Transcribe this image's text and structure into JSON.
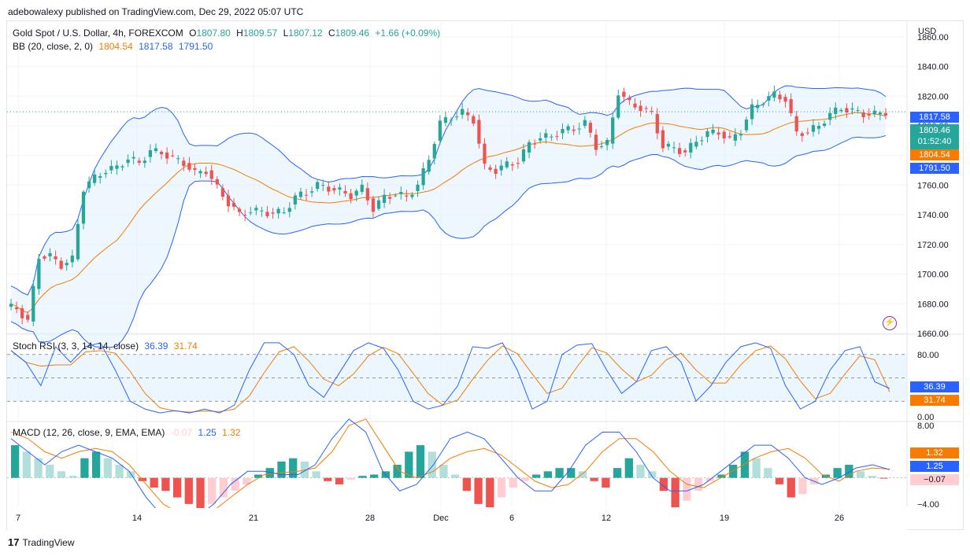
{
  "header": {
    "publisher_text": "adebowalexy published on TradingView.com, Dec 29, 2022 05:07 UTC"
  },
  "footer": {
    "brand": "TradingView"
  },
  "main_legend": {
    "symbol": "Gold Spot / U.S. Dollar, 4h, FOREXCOM",
    "open_label": "O",
    "open": "1807.80",
    "high_label": "H",
    "high": "1809.57",
    "low_label": "L",
    "low": "1807.12",
    "close_label": "C",
    "close": "1809.46",
    "change": "+1.66 (+0.09%)",
    "bb_label": "BB (20, close, 2, 0)",
    "bb_basis": "1804.54",
    "bb_upper": "1817.58",
    "bb_lower": "1791.50"
  },
  "stoch_legend": {
    "label": "Stoch RSI (3, 3, 14, 14, close)",
    "k": "36.39",
    "d": "31.74"
  },
  "macd_legend": {
    "label": "MACD (12, 26, close, 9, EMA, EMA)",
    "hist": "-0.07",
    "macd": "1.25",
    "signal": "1.32"
  },
  "price_axis": {
    "currency": "USD"
  },
  "badges": {
    "upper": "1817.58",
    "price": "1809.46",
    "countdown": "01:52:40",
    "basis": "1804.54",
    "lower": "1791.50",
    "stoch_k": "36.39",
    "stoch_d": "31.74",
    "macd_signal": "1.32",
    "macd_line": "1.25",
    "macd_hist": "−0.07"
  },
  "colors": {
    "up": "#26a69a",
    "down": "#ef5350",
    "bb_band": "#2962ff",
    "bb_basis": "#f57c00",
    "band_fill": "#e3f2fd",
    "stoch_k": "#2962ff",
    "stoch_d": "#f57c00",
    "hist_up_strong": "#26a69a",
    "hist_up_weak": "#b2dfdb",
    "hist_down_strong": "#ef5350",
    "hist_down_weak": "#ffcdd2"
  },
  "chart_data": [
    {
      "type": "candlestick",
      "title": "Gold Spot / U.S. Dollar, 4h, FOREXCOM",
      "x_ticks": [
        "7",
        "14",
        "21",
        "28",
        "Dec",
        "6",
        "12",
        "19",
        "26"
      ],
      "y_ticks": [
        1660,
        1680,
        1700,
        1720,
        1740,
        1760,
        1780,
        1800,
        1820,
        1840,
        1860
      ],
      "y_tick_labels": [
        "1660.00",
        "1680.00",
        "1700.00",
        "1720.00",
        "1740.00",
        "1760.00",
        "1780.00",
        "1800.00",
        "1820.00",
        "1840.00",
        "1860.00"
      ],
      "ylim": [
        1660,
        1870
      ],
      "grid": true,
      "close_path": [
        1678,
        1677,
        1668,
        1712,
        1712,
        1706,
        1710,
        1758,
        1765,
        1770,
        1772,
        1778,
        1775,
        1783,
        1782,
        1778,
        1775,
        1768,
        1770,
        1758,
        1748,
        1740,
        1743,
        1742,
        1741,
        1742,
        1752,
        1755,
        1760,
        1758,
        1756,
        1753,
        1758,
        1744,
        1752,
        1754,
        1752,
        1760,
        1778,
        1802,
        1806,
        1809,
        1804,
        1772,
        1770,
        1774,
        1776,
        1788,
        1792,
        1793,
        1797,
        1798,
        1802,
        1786,
        1788,
        1823,
        1815,
        1812,
        1808,
        1786,
        1785,
        1782,
        1790,
        1795,
        1796,
        1790,
        1797,
        1812,
        1817,
        1821,
        1818,
        1795,
        1796,
        1800,
        1808,
        1812,
        1810,
        1808,
        1807.8,
        1809.46
      ],
      "last_close": 1809.46,
      "bollinger": {
        "basis": 1804.54,
        "upper": 1817.58,
        "lower": 1791.5
      }
    },
    {
      "type": "line",
      "title": "Stoch RSI (3, 3, 14, 14, close)",
      "y_ticks": [
        0,
        80
      ],
      "y_tick_labels": [
        "0.00",
        "80.00"
      ],
      "ylim": [
        -5,
        105
      ],
      "bands": [
        20,
        50,
        80
      ],
      "k_path": [
        85,
        70,
        40,
        90,
        70,
        90,
        95,
        60,
        20,
        10,
        5,
        8,
        5,
        10,
        5,
        15,
        60,
        95,
        95,
        80,
        40,
        25,
        55,
        85,
        95,
        88,
        60,
        20,
        10,
        15,
        40,
        90,
        88,
        95,
        60,
        10,
        20,
        80,
        92,
        94,
        60,
        30,
        45,
        85,
        90,
        70,
        20,
        40,
        70,
        90,
        95,
        88,
        40,
        10,
        20,
        60,
        85,
        90,
        45,
        36.39
      ],
      "series": [
        {
          "name": "K",
          "last": 36.39
        },
        {
          "name": "D",
          "last": 31.74
        }
      ]
    },
    {
      "type": "bar",
      "title": "MACD (12, 26, close, 9, EMA, EMA)",
      "y_ticks": [
        8,
        -4
      ],
      "y_tick_labels": [
        "8.00",
        "−4.00"
      ],
      "ylim": [
        -4.5,
        8.5
      ],
      "hist_path": [
        5,
        4,
        3,
        2,
        1,
        0.3,
        3,
        4,
        3,
        2,
        1,
        -0.5,
        -1.5,
        -2,
        -3,
        -4,
        -5,
        -4,
        -3,
        -2,
        -1,
        0.5,
        1.5,
        2.5,
        3,
        2.5,
        1,
        -0.5,
        -1,
        -0.3,
        0.3,
        0.5,
        1,
        2,
        4,
        5,
        4,
        2,
        0.5,
        -2,
        -4,
        -4.5,
        -3,
        -1.5,
        -0.5,
        0.5,
        1,
        1.5,
        1.5,
        1,
        -0.5,
        -1.5,
        1.5,
        3,
        2,
        1,
        -2,
        -4.5,
        -3.5,
        -2,
        -0.5,
        0.5,
        2,
        4,
        3,
        1.5,
        -1,
        -3,
        -2.5,
        -1,
        0.5,
        1.5,
        2,
        1,
        0.3,
        -0.07
      ],
      "macd_path": [
        6,
        4,
        2,
        4,
        5,
        4,
        3,
        1,
        -3,
        -6,
        -7,
        -6,
        -4,
        -1,
        1,
        1,
        0.5,
        0.5,
        2,
        6,
        9,
        7,
        1,
        -2,
        -1,
        2,
        6,
        7,
        6,
        3,
        0,
        -2,
        -2,
        1,
        5,
        7,
        7,
        4,
        0,
        -2,
        -2,
        -1,
        1,
        3,
        5,
        5,
        3,
        0,
        -1,
        0,
        1.5,
        2,
        1.25
      ],
      "signal_path": [
        7,
        6,
        4,
        3,
        4,
        4.5,
        4,
        2,
        -1,
        -4,
        -5.5,
        -6,
        -5,
        -3,
        -1,
        0.5,
        0.8,
        1,
        1.5,
        4,
        8,
        9,
        5,
        1,
        0,
        1,
        3,
        4,
        4.5,
        3.5,
        1.5,
        -0.5,
        -1.5,
        -1,
        1,
        4,
        6,
        6,
        4,
        1,
        -1,
        -1.5,
        0,
        1.5,
        3,
        4,
        4.5,
        3,
        0.5,
        -0.5,
        1,
        1.5,
        1.32
      ],
      "series": [
        {
          "name": "Histogram",
          "last": -0.07
        },
        {
          "name": "MACD",
          "last": 1.25
        },
        {
          "name": "Signal",
          "last": 1.32
        }
      ]
    }
  ]
}
